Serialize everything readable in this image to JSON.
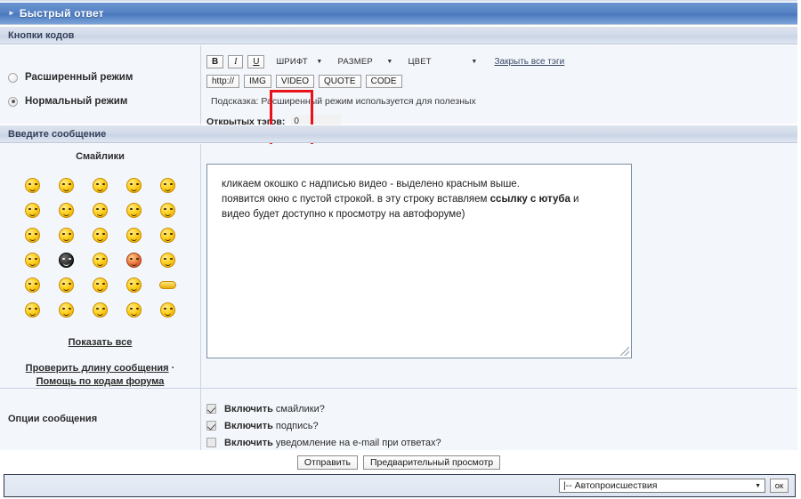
{
  "window": {
    "title": "Быстрый ответ",
    "title_arrow": "chevron-right-icon"
  },
  "sections": {
    "codes_bar": "Кнопки кодов",
    "message_bar": "Введите сообщение"
  },
  "mode": {
    "options": [
      {
        "label": "Расширенный режим",
        "selected": false
      },
      {
        "label": "Нормальный режим",
        "selected": true
      }
    ]
  },
  "toolbar": {
    "row1": [
      {
        "name": "bold",
        "label": "B"
      },
      {
        "name": "italic",
        "label": "I"
      },
      {
        "name": "underline",
        "label": "U"
      }
    ],
    "selects": [
      {
        "name": "font",
        "label": "ШРИФТ",
        "arrow": "▼"
      },
      {
        "name": "size",
        "label": "РАЗМЕР",
        "arrow": "▼"
      },
      {
        "name": "color",
        "label": "ЦВЕТ",
        "arrow": "▼"
      }
    ],
    "close_all_tags": "Закрыть все тэги",
    "row2": [
      {
        "name": "url",
        "label": "http://"
      },
      {
        "name": "img",
        "label": "IMG"
      },
      {
        "name": "video",
        "label": "VIDEO"
      },
      {
        "name": "quote",
        "label": "QUOTE"
      },
      {
        "name": "code",
        "label": "CODE"
      }
    ],
    "hint": "Подсказка: Расширенный режим используется для полезных",
    "open_tags_label": "Открытых тэгов:",
    "open_tags_value": "0",
    "highlight_color": "#e8131a"
  },
  "smilies": {
    "title": "Смайлики",
    "show_all": "Показать все",
    "check_length": "Проверить длину сообщения",
    "separator": "·",
    "help_codes": "Помощь по кодам форума",
    "grid": [
      [
        "smiley-grin",
        "smiley-roll-eyes",
        "smiley-dizzy",
        "smiley-neutral",
        "smiley-smirk"
      ],
      [
        "smiley-shocked",
        "smiley-wink",
        "smiley-tongue",
        "smiley-teeth",
        "smiley-cool"
      ],
      [
        "smiley-happy",
        "smiley-sly",
        "smiley-laugh",
        "smiley-silent",
        "smiley-squint"
      ],
      [
        "smiley-stare",
        "smiley-ninja",
        "smiley-pacman",
        "smiley-angry-red",
        "smiley-wave"
      ],
      [
        "smiley-think",
        "smiley-bored",
        "smiley-hug",
        "smiley-cry",
        "smiley-sleep-flat"
      ],
      [
        "smiley-blush",
        "smiley-sleepy",
        "smiley-facepalm",
        "smiley-lol",
        "smiley-mad"
      ]
    ]
  },
  "editor": {
    "lines": [
      {
        "text": "кликаем окошко с надписью видео - выделено красным выше.",
        "bold_part": ""
      },
      {
        "text": " появится окно с пустой строкой. в эту строку вставляем ",
        "bold_part": "ссылку с ютуба",
        "tail": " и"
      },
      {
        "text": "видео будет доступно к просмотру на автофоруме)",
        "bold_part": ""
      }
    ],
    "resize_handle": "resize-grip-icon"
  },
  "options": {
    "label": "Опции сообщения",
    "items": [
      {
        "bold": "Включить",
        "rest": " смайлики?",
        "checked": true
      },
      {
        "bold": "Включить",
        "rest": " подпись?",
        "checked": true
      },
      {
        "bold": "Включить",
        "rest": " уведомление на e-mail при ответах?",
        "checked": false
      }
    ]
  },
  "submit": {
    "send": "Отправить",
    "preview": "Предварительный просмотр"
  },
  "jump": {
    "selected": "|-- Автопроисшествия",
    "arrow": "▼",
    "ok": "ок"
  }
}
